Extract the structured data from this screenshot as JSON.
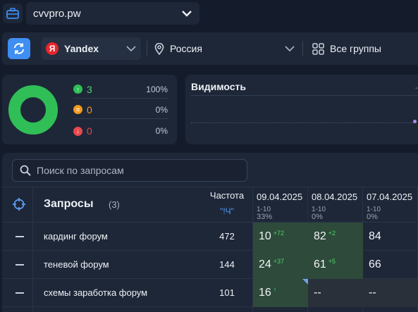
{
  "project": {
    "name": "cvvpro.pw"
  },
  "filters": {
    "engine": "Yandex",
    "engine_logo": "Я",
    "region": "Россия",
    "groups": "Все группы"
  },
  "stats": {
    "up": {
      "count": "3",
      "percent": "100%"
    },
    "same": {
      "count": "0",
      "percent": "0%"
    },
    "down": {
      "count": "0",
      "percent": "0%"
    }
  },
  "visibility": {
    "title": "Видимость",
    "tick": "-"
  },
  "search": {
    "placeholder": "Поиск по запросам"
  },
  "table": {
    "title": "Запросы",
    "count": "(3)",
    "freq_header": "Частота",
    "freq_sub": "\"!Ч\"",
    "dates": [
      {
        "date": "09.04.2025",
        "range": "1-10",
        "pct": "33%"
      },
      {
        "date": "08.04.2025",
        "range": "1-10",
        "pct": "0%"
      },
      {
        "date": "07.04.2025",
        "range": "1-10",
        "pct": "0%"
      }
    ],
    "rows": [
      {
        "keyword": "кардинг форум",
        "freq": "472",
        "pos": [
          {
            "v": "10",
            "d": "+72"
          },
          {
            "v": "82",
            "d": "+2"
          },
          {
            "v": "84",
            "d": ""
          }
        ]
      },
      {
        "keyword": "теневой форум",
        "freq": "144",
        "pos": [
          {
            "v": "24",
            "d": "+37"
          },
          {
            "v": "61",
            "d": "+5"
          },
          {
            "v": "66",
            "d": ""
          }
        ]
      },
      {
        "keyword": "схемы заработка форум",
        "freq": "101",
        "pos": [
          {
            "v": "16",
            "d": "↑"
          },
          {
            "v": "--",
            "d": ""
          },
          {
            "v": "--",
            "d": ""
          }
        ]
      }
    ]
  },
  "colors": {
    "accent": "#3f8ef2",
    "positive": "#2fbf56",
    "neutral": "#f39a1e",
    "negative": "#e8484f"
  }
}
